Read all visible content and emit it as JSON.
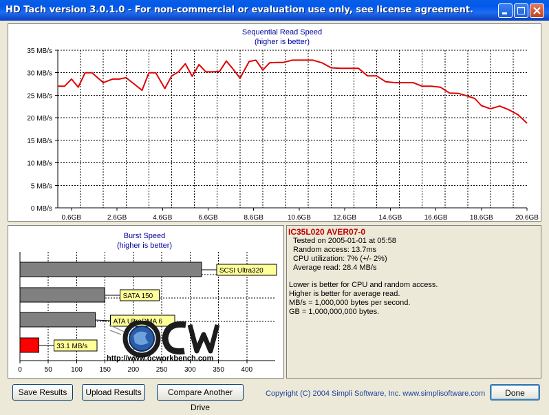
{
  "window": {
    "title": "HD Tach version 3.0.1.0  - For non-commercial or evaluation use only, see license agreement.",
    "controls": [
      "minimize-icon",
      "maximize-icon",
      "close-icon"
    ]
  },
  "seq_chart": {
    "title": "Sequential Read Speed",
    "subtitle": "(higher is better)"
  },
  "burst_chart": {
    "title": "Burst Speed",
    "subtitle": "(higher is better)",
    "watermark_url": "http://www.ocworkbench.com"
  },
  "chart_data": [
    {
      "type": "line",
      "title": "Sequential Read Speed",
      "subtitle": "(higher is better)",
      "y_ticks": [
        "35 MB/s",
        "30 MB/s",
        "25 MB/s",
        "20 MB/s",
        "15 MB/s",
        "10 MB/s",
        "5 MB/s",
        "0 MB/s"
      ],
      "x_ticks": [
        "0.6GB",
        "2.6GB",
        "4.6GB",
        "6.6GB",
        "8.6GB",
        "10.6GB",
        "12.6GB",
        "14.6GB",
        "16.6GB",
        "18.6GB",
        "20.6GB"
      ],
      "ylim": [
        0,
        35
      ],
      "xlim": [
        0,
        20.6
      ],
      "grid": true,
      "color": "#E00000",
      "x": [
        0,
        0.3,
        0.6,
        0.9,
        1.2,
        1.5,
        2.0,
        2.4,
        2.7,
        3.0,
        3.4,
        3.7,
        4.0,
        4.3,
        4.7,
        5.0,
        5.3,
        5.6,
        5.9,
        6.2,
        6.5,
        6.8,
        7.1,
        7.4,
        7.7,
        8.0,
        8.4,
        8.7,
        9.0,
        9.3,
        9.6,
        9.9,
        10.3,
        10.6,
        11.2,
        11.6,
        12.0,
        12.4,
        12.8,
        13.2,
        13.6,
        14.0,
        14.4,
        14.8,
        15.2,
        15.6,
        16.0,
        16.4,
        16.8,
        17.2,
        17.6,
        18.0,
        18.3,
        18.6,
        19.0,
        19.4,
        19.8,
        20.2,
        20.6
      ],
      "values": [
        27,
        27,
        28.6,
        26.8,
        30,
        30,
        27.8,
        28.6,
        28.6,
        28.9,
        27.3,
        26.1,
        30,
        30,
        26.5,
        29.3,
        30.2,
        32,
        29.2,
        31.8,
        30.2,
        30.2,
        30.3,
        32.6,
        30.8,
        28.8,
        32.5,
        32.8,
        30.6,
        32.2,
        32.3,
        32.3,
        32.8,
        32.8,
        32.8,
        32.2,
        31.1,
        31,
        31,
        31,
        29.3,
        29.3,
        28,
        27.8,
        27.8,
        27.8,
        27,
        27,
        26.8,
        25.5,
        25.4,
        24.8,
        24.3,
        22.7,
        22,
        22.6,
        21.8,
        20.7,
        18.8
      ]
    },
    {
      "type": "bar",
      "title": "Burst Speed",
      "subtitle": "(higher is better)",
      "orientation": "horizontal",
      "xlim": [
        0,
        450
      ],
      "x_ticks": [
        "0",
        "50",
        "100",
        "150",
        "200",
        "250",
        "300",
        "350",
        "400"
      ],
      "categories": [
        "SCSI Ultra320",
        "SATA 150",
        "ATA UltraDMA 6",
        "33.1 MB/s"
      ],
      "values": [
        320,
        150,
        133,
        33.1
      ],
      "colors": [
        "#808080",
        "#808080",
        "#808080",
        "#FF0000"
      ],
      "grid": true
    }
  ],
  "results": {
    "drive_name": "IC35L020 AVER07-0",
    "tested_on": "Tested on 2005-01-01 at 05:58",
    "random_access": "Random access: 13.7ms",
    "cpu_utilization": "CPU utilization: 7% (+/- 2%)",
    "average_read": "Average read: 28.4 MB/s",
    "note_1": "Lower is better for CPU and random access.",
    "note_2": "Higher is better for average read.",
    "note_3": "MB/s = 1,000,000 bytes per second.",
    "note_4": "GB = 1,000,000,000 bytes."
  },
  "buttons": {
    "save": "Save Results",
    "upload": "Upload Results",
    "compare": "Compare Another Drive",
    "done": "Done"
  },
  "footer": {
    "copyright": "Copyright (C) 2004 Simpli Software, Inc. www.simplisoftware.com"
  }
}
